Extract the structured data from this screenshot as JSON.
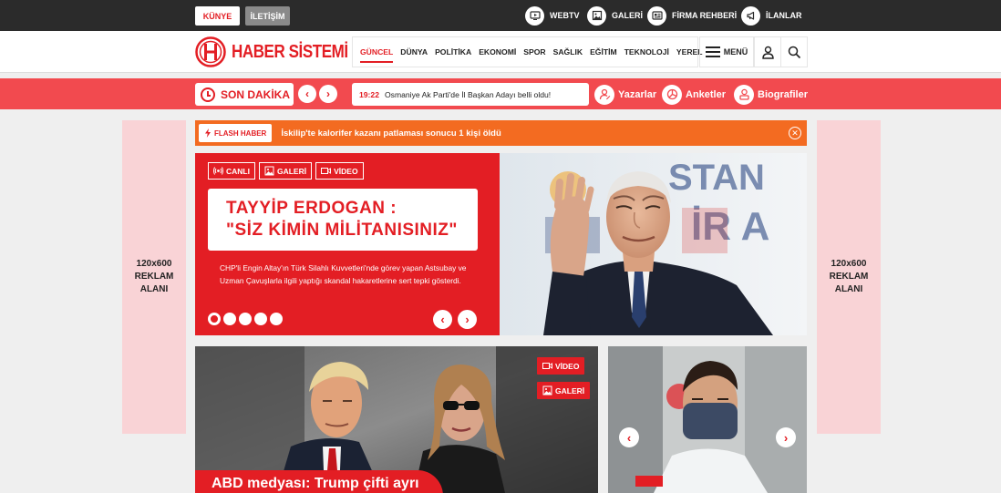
{
  "topbar": {
    "kunye": "KÜNYE",
    "iletisim": "İLETİŞİM",
    "links": [
      {
        "label": "WEBTV",
        "icon": "tv-icon"
      },
      {
        "label": "GALERİ",
        "icon": "image-icon"
      },
      {
        "label": "FİRMA REHBERİ",
        "icon": "directory-icon"
      },
      {
        "label": "İLANLAR",
        "icon": "megaphone-icon"
      }
    ]
  },
  "header": {
    "logo_text": "HABER SİSTEMİ",
    "nav": [
      "GÜNCEL",
      "DÜNYA",
      "POLİTİKA",
      "EKONOMİ",
      "SPOR",
      "SAĞLIK",
      "EĞİTİM",
      "TEKNOLOJİ",
      "YEREL"
    ],
    "menu_label": "MENÜ"
  },
  "breaking": {
    "label": "SON DAKİKA",
    "time": "19:22",
    "headline": "Osmaniye Ak Parti'de İl Başkan Adayı belli oldu!",
    "links": [
      "Yazarlar",
      "Anketler",
      "Biografiler"
    ]
  },
  "ads": {
    "left": [
      "120x600",
      "REKLAM",
      "ALANI"
    ],
    "right": [
      "120x600",
      "REKLAM",
      "ALANI"
    ]
  },
  "flash": {
    "badge": "FLASH HABER",
    "text": "İskilip'te kalorifer kazanı patlaması sonucu 1 kişi öldü"
  },
  "hero": {
    "tags": [
      "CANLI",
      "GALERİ",
      "VİDEO"
    ],
    "title_line1": "TAYYİP ERDOGAN :",
    "title_line2": "\"SİZ KİMİN MİLİTANISINIZ\"",
    "description": "CHP'li Engin Altay'ın Türk Silahlı Kuvvetleri'nde görev yapan Astsubay ve Uzman Çavuşlarla ilgili yaptığı skandal hakaretlerine sert tepki gösterdi.",
    "slide_count": 5,
    "active_slide": 1
  },
  "cards": {
    "big": {
      "tags": [
        "VİDEO",
        "GALERİ"
      ],
      "caption": "ABD medyası: Trump çifti ayrı"
    }
  },
  "colors": {
    "brand_red": "#e31e24",
    "breaking_bar": "#f24a4f",
    "flash_orange": "#f36b21",
    "ad_pink": "#f9d3d6",
    "topbar_dark": "#2b2b2b"
  }
}
